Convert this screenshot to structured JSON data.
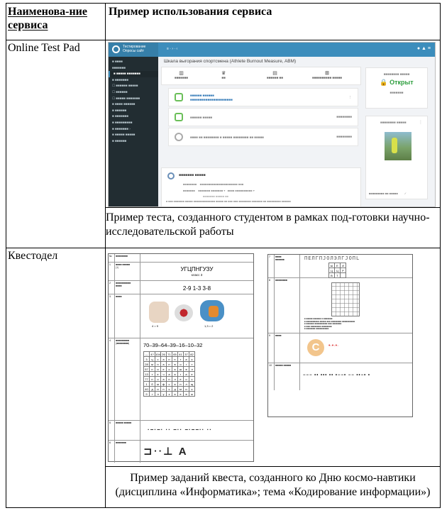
{
  "header": {
    "col1": "Наименова-ние сервиса",
    "col2": "Пример использования сервиса"
  },
  "rows": [
    {
      "name": "Online Test Pad",
      "caption": "Пример теста, созданного студентом в рамках под-готовки научно-исследовательской работы",
      "screenshot": {
        "title": "Шкала выгорания спортсмена (Athlete Burnout Measure, ABM)",
        "open_label": "Открыт"
      }
    },
    {
      "name": "Квестодел",
      "caption": "Пример заданий квеста, созданного ко Дню космо-навтики (дисциплина «Информатика»; тема «Кодирование информации»)",
      "quest_left": {
        "org": "УГЦПНГУЗУ",
        "sub": "класс 3",
        "code": "2-9 1-3 3-8",
        "seq": "70–39–64–39–16–10–32",
        "eq1": "4 = 9",
        "eq2": "1,3 = 2"
      },
      "quest_right": {
        "cipher": "ПЕЛГПJОЛЭЛГJОПL"
      }
    }
  ]
}
